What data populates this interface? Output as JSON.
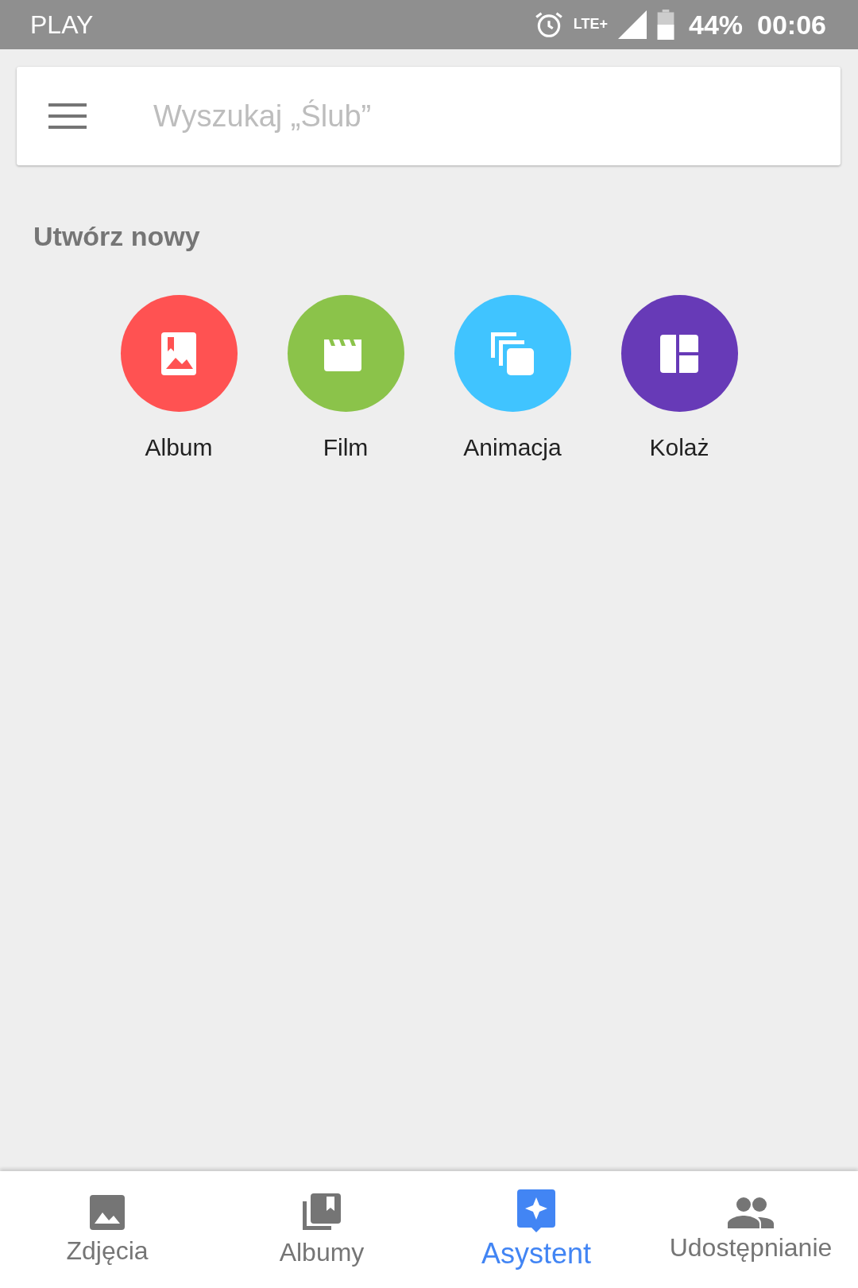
{
  "status_bar": {
    "carrier": "PLAY",
    "network": "LTE+",
    "battery": "44%",
    "time": "00:06"
  },
  "search": {
    "placeholder": "Wyszukaj „Ślub”"
  },
  "section_title": "Utwórz nowy",
  "create_items": [
    {
      "kind": "album",
      "label": "Album",
      "color": "#ff5252"
    },
    {
      "kind": "film",
      "label": "Film",
      "color": "#8bc34a"
    },
    {
      "kind": "animation",
      "label": "Animacja",
      "color": "#40c4ff"
    },
    {
      "kind": "collage",
      "label": "Kolaż",
      "color": "#673ab7"
    }
  ],
  "bottom_nav": [
    {
      "kind": "photos",
      "label": "Zdjęcia",
      "selected": false
    },
    {
      "kind": "albums",
      "label": "Albumy",
      "selected": false
    },
    {
      "kind": "assistant",
      "label": "Asystent",
      "selected": true
    },
    {
      "kind": "sharing",
      "label": "Udostępnianie",
      "selected": false
    }
  ]
}
